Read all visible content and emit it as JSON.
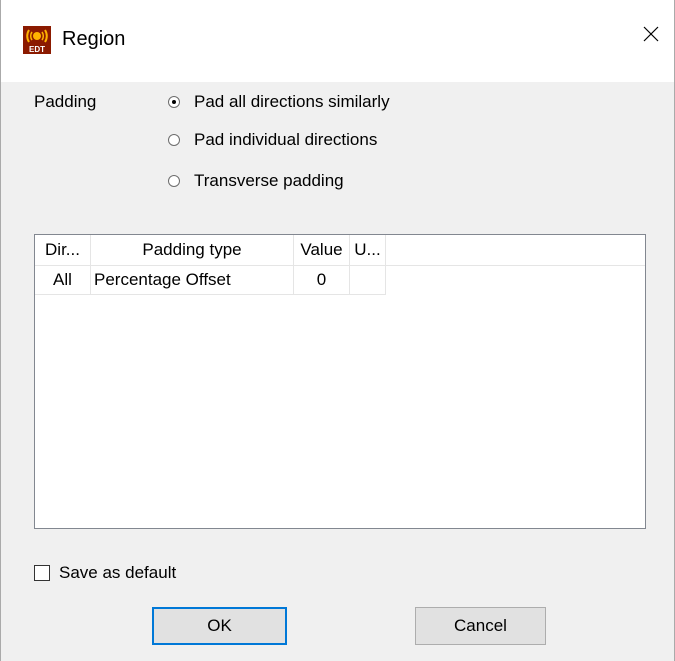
{
  "window": {
    "title": "Region",
    "icon": "edt-app-icon",
    "icon_text": "EDT",
    "close_icon": "close-icon"
  },
  "padding": {
    "label": "Padding",
    "options": [
      {
        "label": "Pad all directions similarly",
        "checked": true
      },
      {
        "label": "Pad individual directions",
        "checked": false
      },
      {
        "label": "Transverse padding",
        "checked": false
      }
    ]
  },
  "table": {
    "headers": [
      "Dir...",
      "Padding type",
      "Value",
      "U..."
    ],
    "rows": [
      {
        "dir": "All",
        "type": "Percentage Offset",
        "value": "0",
        "unit": ""
      }
    ]
  },
  "save_default": {
    "label": "Save as default",
    "checked": false
  },
  "buttons": {
    "ok": "OK",
    "cancel": "Cancel"
  }
}
